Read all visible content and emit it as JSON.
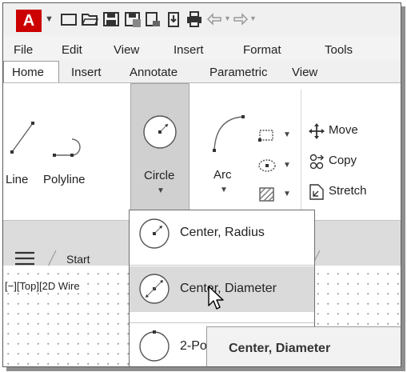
{
  "app_button": {
    "letter": "A"
  },
  "quick_access": {
    "icons": [
      "new-file-icon",
      "open-folder-icon",
      "save-icon",
      "save-as-icon",
      "export-icon",
      "publish-icon",
      "print-icon",
      "undo-icon",
      "redo-icon"
    ]
  },
  "menu": {
    "items": [
      "File",
      "Edit",
      "View",
      "Insert",
      "Format",
      "Tools"
    ]
  },
  "ribbon_tabs": {
    "items": [
      "Home",
      "Insert",
      "Annotate",
      "Parametric",
      "View"
    ],
    "active": "Home"
  },
  "draw_panel": {
    "line_label": "Line",
    "polyline_label": "Polyline",
    "circle_label": "Circle",
    "arc_label": "Arc"
  },
  "modify_panel": {
    "move_label": "Move",
    "copy_label": "Copy",
    "stretch_label": "Stretch"
  },
  "file_tabs": {
    "start_label": "Start"
  },
  "viewport": {
    "label": "[−][Top][2D Wire"
  },
  "circle_dropdown": {
    "items": [
      "Center, Radius",
      "Center, Diameter",
      "2-Po"
    ],
    "highlighted": "Center, Diameter"
  },
  "tooltip": {
    "title": "Center, Diameter"
  },
  "colors": {
    "app_button": "#cc0000",
    "highlight": "#dadada",
    "ribbon": "#ffffff",
    "background": "#f0f0f0"
  }
}
